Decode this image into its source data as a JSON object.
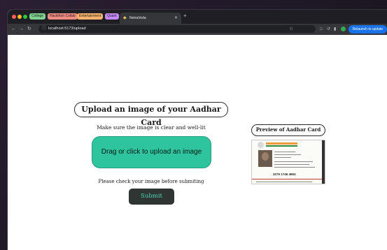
{
  "browser": {
    "tab_groups": [
      "College",
      "Hackthon Collab",
      "Entertainment",
      "Quant"
    ],
    "active_tab": {
      "title": "NetraVeda"
    },
    "address": "localhost:5173/upload",
    "relaunch_label": "Relaunch to update"
  },
  "page": {
    "upload_title": "Upload an image of your Aadhar Card",
    "hint": "Make sure the image is clear and well-lit",
    "dropzone_label": "Drag or click to upload an image",
    "check_text": "Please check your image before submiting",
    "submit_label": "Submit",
    "preview_title": "Preview of Aadhar Card",
    "preview_card_number": "3275 1746 4653"
  },
  "colors": {
    "dropzone": "#2ec49d",
    "submit_bg": "#2f3533",
    "submit_text": "#4dd4ae",
    "relaunch": "#1a73e8"
  }
}
